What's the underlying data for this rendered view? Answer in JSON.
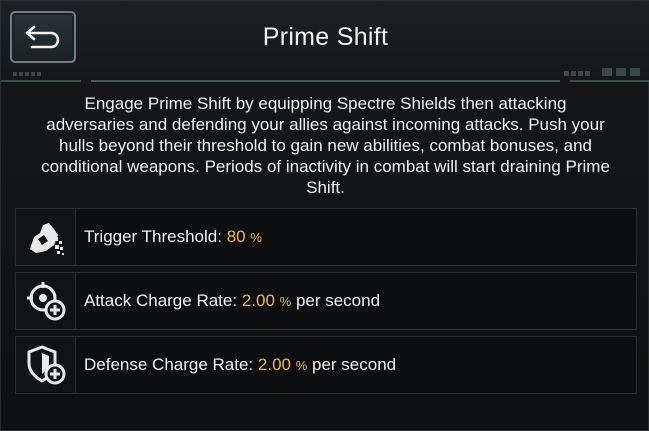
{
  "header": {
    "title": "Prime Shift",
    "back_icon": "back-arrow-icon"
  },
  "description": "Engage Prime Shift by equipping Spectre Shields then attacking adversaries and defending your allies against incoming attacks. Push your hulls beyond their threshold to gain new abilities, combat bonuses, and conditional weapons. Periods of inactivity in combat will start draining Prime Shift.",
  "stats": [
    {
      "icon": "trigger-threshold-icon",
      "label": "Trigger Threshold:",
      "value": "80",
      "unit": "%",
      "suffix": ""
    },
    {
      "icon": "attack-charge-icon",
      "label": "Attack Charge Rate:",
      "value": "2.00",
      "unit": "%",
      "suffix": "per second"
    },
    {
      "icon": "defense-charge-icon",
      "label": "Defense Charge Rate:",
      "value": "2.00",
      "unit": "%",
      "suffix": "per second"
    }
  ],
  "colors": {
    "accent": "#f5b25d",
    "text": "#f2f2f2",
    "background": "#0e1011"
  }
}
